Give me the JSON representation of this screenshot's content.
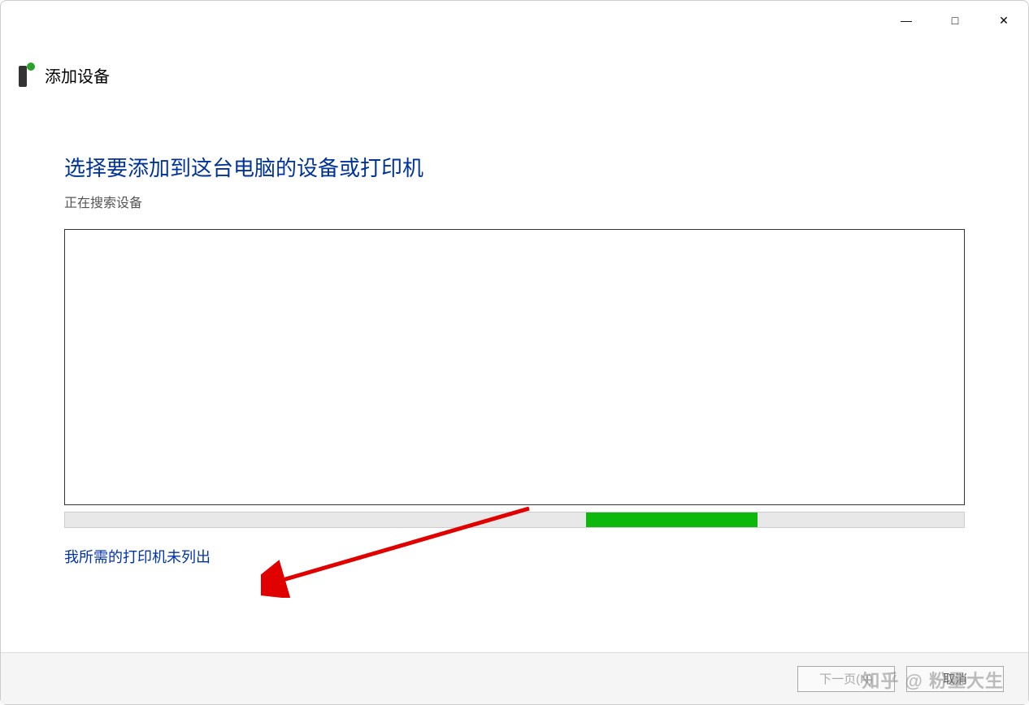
{
  "window": {
    "minimize_symbol": "—",
    "maximize_symbol": "□",
    "close_symbol": "✕"
  },
  "header": {
    "title": "添加设备"
  },
  "content": {
    "heading": "选择要添加到这台电脑的设备或打印机",
    "status": "正在搜索设备",
    "link_not_listed": "我所需的打印机未列出"
  },
  "progress": {
    "left_pct": 58,
    "width_pct": 19
  },
  "footer": {
    "next_label": "下一页(N)",
    "cancel_label": "取消"
  },
  "watermark": "知乎 @ 粉墨大生"
}
